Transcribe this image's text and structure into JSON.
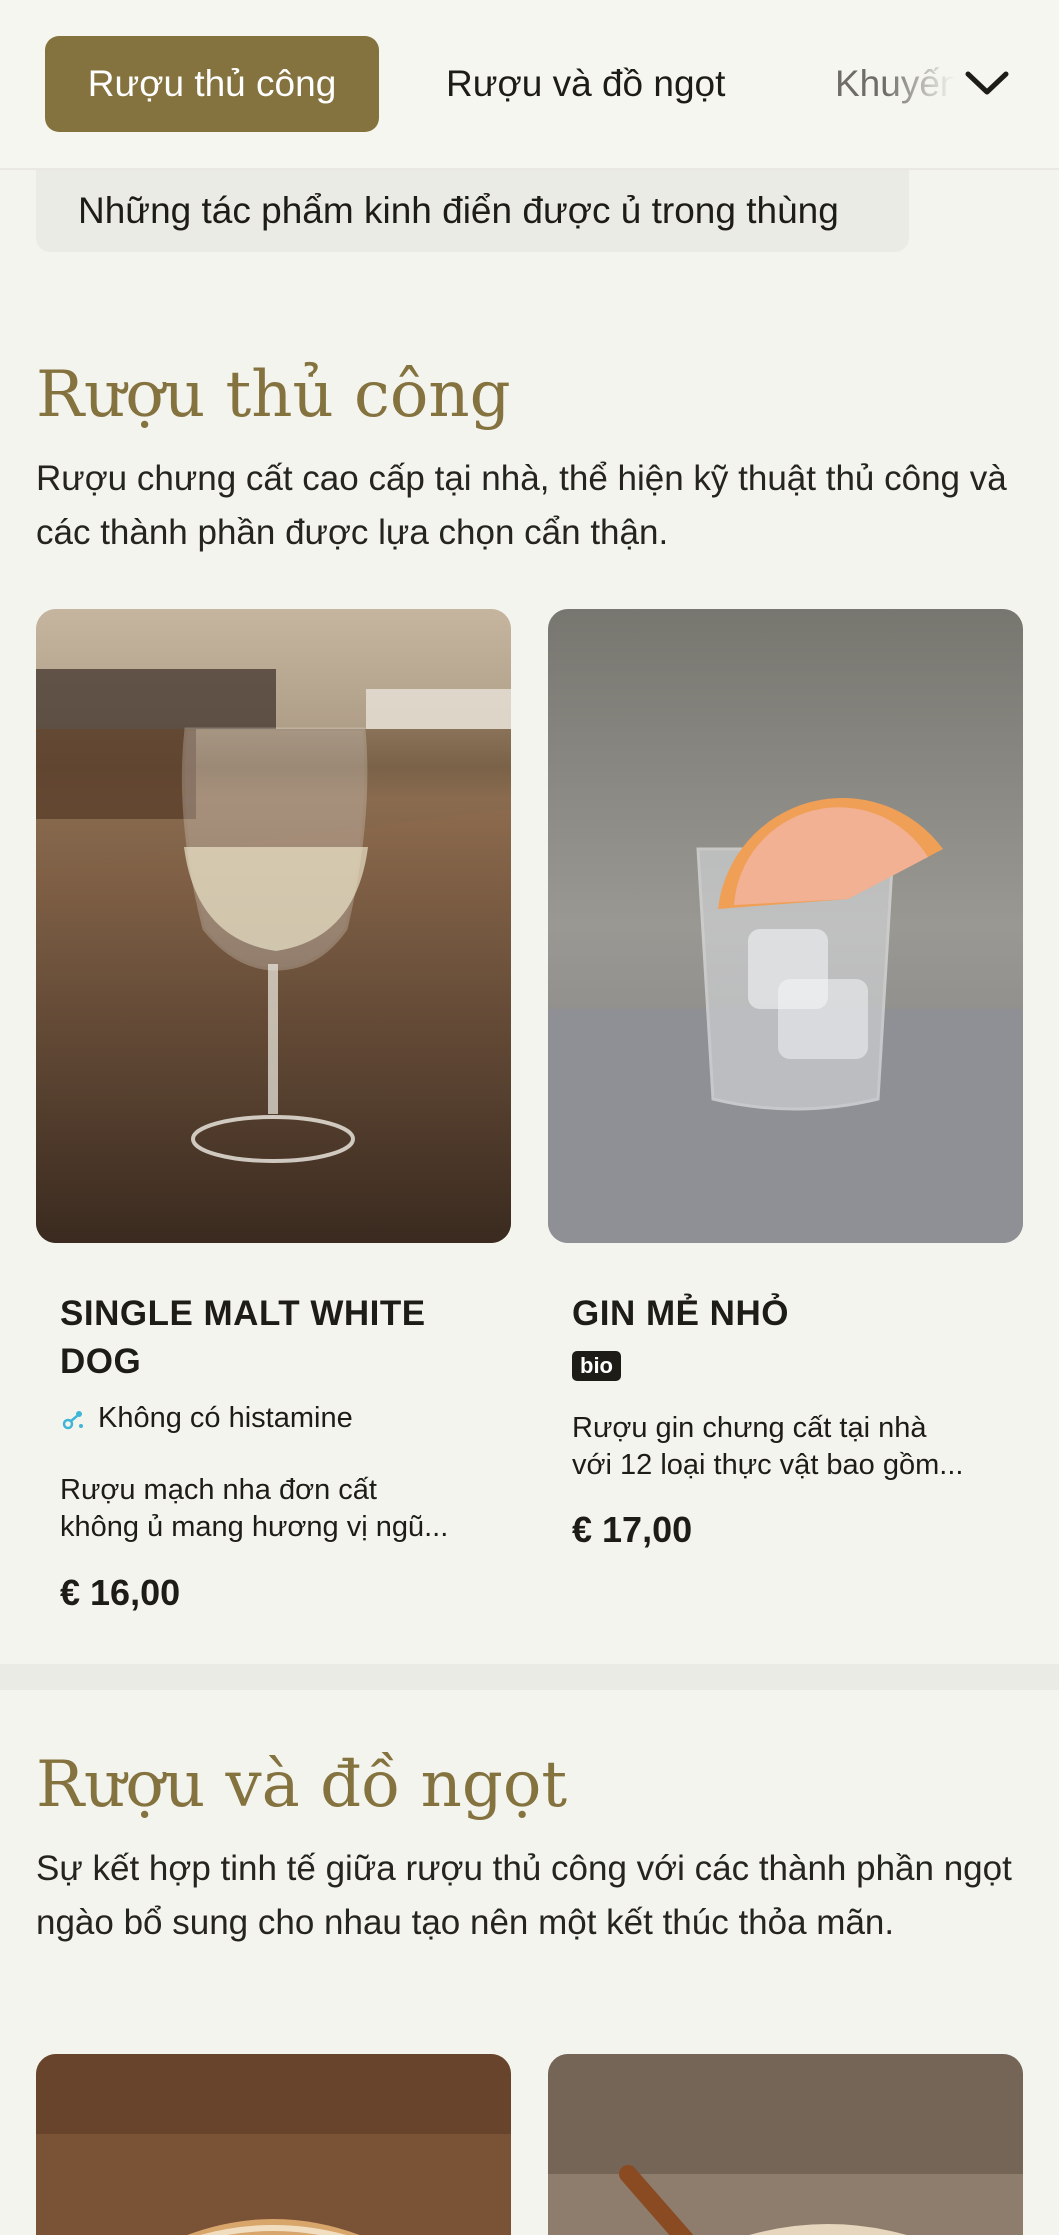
{
  "tabs": [
    {
      "label": "Rượu thủ công",
      "active": true
    },
    {
      "label": "Rượu và đồ ngọt",
      "active": false
    },
    {
      "label": "Khuyến mãi",
      "active": false
    }
  ],
  "subcategory": "Những tác phẩm kinh điển được ủ trong thùng",
  "sections": [
    {
      "title": "Rượu thủ công",
      "description": "Rượu chưng cất cao cấp tại nhà, thể hiện kỹ thuật thủ công và các thành phần được lựa chọn cẩn thận.",
      "products": [
        {
          "name_line1": "SINGLE MALT WHITE",
          "name_line2": "DOG",
          "allergen": "Không có histamine",
          "desc_line1": "Rượu mạch nha đơn cất",
          "desc_line2": "không ủ mang hương vị ngũ...",
          "price": "€ 16,00",
          "image_icon": "wine-glass-image"
        },
        {
          "name_line1": "GIN MẺ NHỎ",
          "badge": "bio",
          "desc_line1": "Rượu gin chưng cất tại nhà",
          "desc_line2": "với 12 loại thực vật bao gồm...",
          "price": "€ 17,00",
          "image_icon": "gin-tonic-image"
        }
      ]
    },
    {
      "title": "Rượu và đồ ngọt",
      "description": "Sự kết hợp tinh tế giữa rượu thủ công với các thành phần ngọt ngào bổ sung cho nhau tạo nên một kết thúc thỏa mãn."
    }
  ],
  "colors": {
    "accent": "#85733f",
    "background": "#f4f4ef",
    "text": "#1e1c17",
    "allergen_icon": "#3fb6d6"
  }
}
